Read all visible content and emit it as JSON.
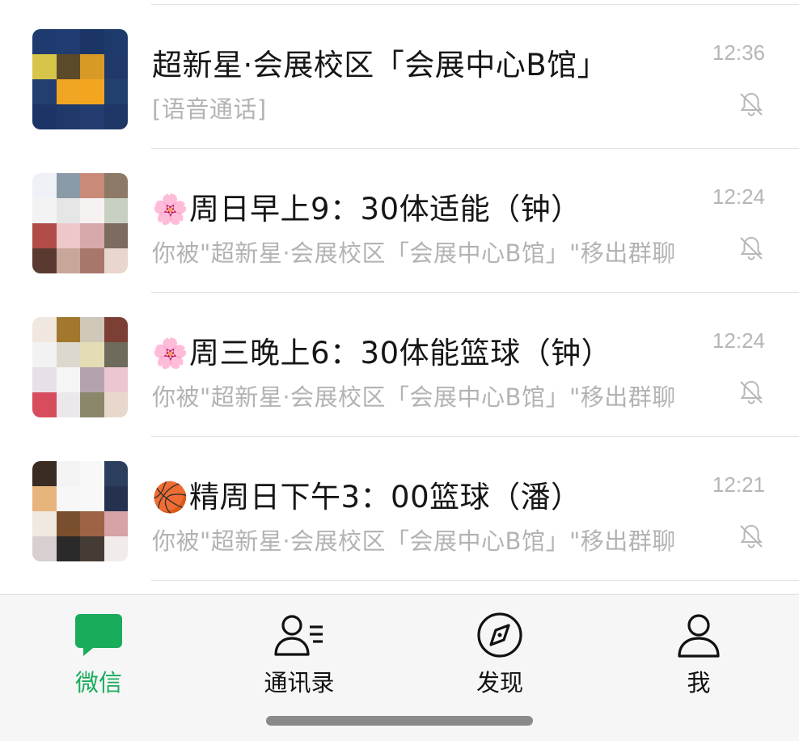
{
  "chats": [
    {
      "title": "超新星·会展校区「会展中心B馆」",
      "emoji": "",
      "preview": "[语音通话]",
      "time": "12:36",
      "muted": true,
      "avatar_colors": [
        "#1e3a6e",
        "#203c70",
        "#1b3566",
        "#1e3a6c",
        "#d7c54a",
        "#5b4a2a",
        "#d89a26",
        "#21396a",
        "#233e70",
        "#f0a523",
        "#f2a51f",
        "#22406e",
        "#1c3566",
        "#1f3a6a",
        "#233d70",
        "#1e3767"
      ]
    },
    {
      "title": "周日早上9：30体适能（钟）",
      "emoji": "🌸",
      "preview": "你被\"超新星·会展校区「会展中心B馆」\"移出群聊",
      "time": "12:24",
      "muted": true,
      "avatar_colors": [
        "#eef1f5",
        "#8a9aa6",
        "#c98a7a",
        "#8c7a66",
        "#f3f3f3",
        "#e6e6e6",
        "#f6f2f2",
        "#c8d0c2",
        "#b14c48",
        "#eec8c8",
        "#d7a9aa",
        "#7e6b5f",
        "#5a3a30",
        "#c8a79a",
        "#a8776c",
        "#e9d6cf"
      ]
    },
    {
      "title": "周三晚上6：30体能篮球（钟）",
      "emoji": "🌸",
      "preview": "你被\"超新星·会展校区「会展中心B馆」\"移出群聊",
      "time": "12:24",
      "muted": true,
      "avatar_colors": [
        "#f0e7de",
        "#a1782e",
        "#cfc7b8",
        "#7c3f35",
        "#f2f2f2",
        "#dcd8ce",
        "#e4dcb4",
        "#6e6a5c",
        "#e7e0e8",
        "#f5f5f5",
        "#b4a3ae",
        "#ecc6d0",
        "#d74d5d",
        "#ece7ea",
        "#8a876a",
        "#e8d8cc"
      ]
    },
    {
      "title": "精周日下午3：00篮球（潘）",
      "emoji": "🏀",
      "preview": "你被\"超新星·会展校区「会展中心B馆」\"移出群聊",
      "time": "12:21",
      "muted": true,
      "avatar_colors": [
        "#3a2c22",
        "#f4f4f4",
        "#f8f8f8",
        "#2c3e5e",
        "#e7b47e",
        "#f7f7f7",
        "#f8f8f8",
        "#24314f",
        "#f0e9e0",
        "#7a4f2e",
        "#9c6444",
        "#d7a3a6",
        "#d8d0d0",
        "#2a2a2a",
        "#453c35",
        "#f1eceb"
      ]
    }
  ],
  "tabs": [
    {
      "label": "微信",
      "icon": "chat-bubble-icon",
      "active": true
    },
    {
      "label": "通讯录",
      "icon": "contacts-icon",
      "active": false
    },
    {
      "label": "发现",
      "icon": "compass-icon",
      "active": false
    },
    {
      "label": "我",
      "icon": "person-icon",
      "active": false
    }
  ],
  "colors": {
    "accent": "#19ac5b",
    "title": "#161616",
    "muted_text": "#b3b3b3",
    "tab_bar_bg": "#f6f6f6"
  }
}
